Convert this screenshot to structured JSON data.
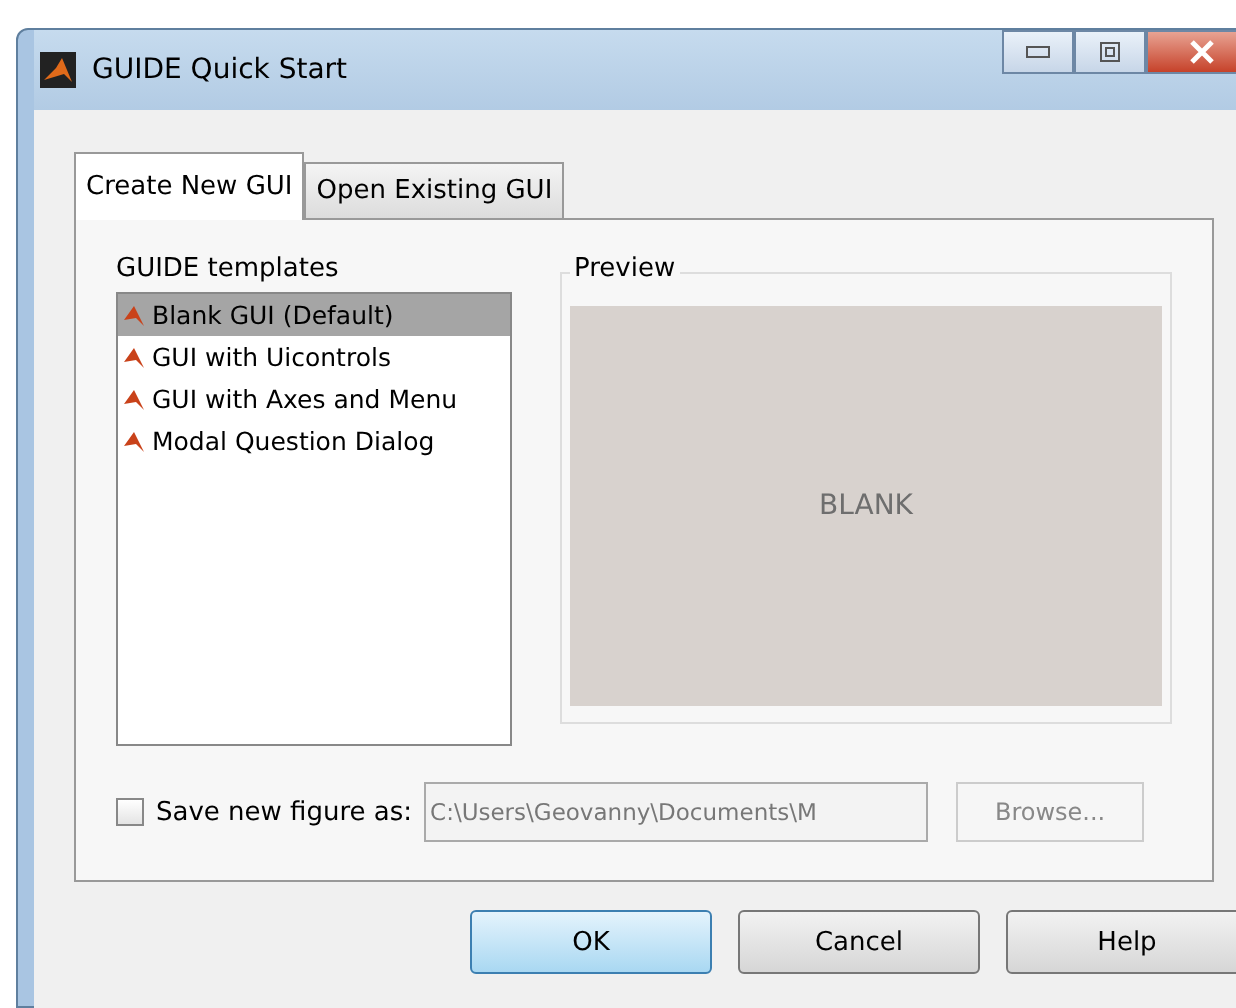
{
  "window": {
    "title": "GUIDE Quick Start"
  },
  "tabs": [
    {
      "label": "Create New GUI",
      "selected": true
    },
    {
      "label": "Open Existing GUI",
      "selected": false
    }
  ],
  "templates": {
    "label": "GUIDE templates",
    "items": [
      {
        "label": "Blank GUI (Default)",
        "selected": true
      },
      {
        "label": "GUI with Uicontrols",
        "selected": false
      },
      {
        "label": "GUI with Axes and Menu",
        "selected": false
      },
      {
        "label": "Modal Question Dialog",
        "selected": false
      }
    ]
  },
  "preview": {
    "label": "Preview",
    "text": "BLANK"
  },
  "save": {
    "label": "Save new figure as:",
    "checked": false,
    "value": "C:\\Users\\Geovanny\\Documents\\M",
    "disabled": true,
    "browse": "Browse..."
  },
  "buttons": [
    {
      "label": "OK",
      "kind": "default"
    },
    {
      "label": "Cancel",
      "kind": "normal"
    },
    {
      "label": "Help",
      "kind": "normal"
    }
  ]
}
